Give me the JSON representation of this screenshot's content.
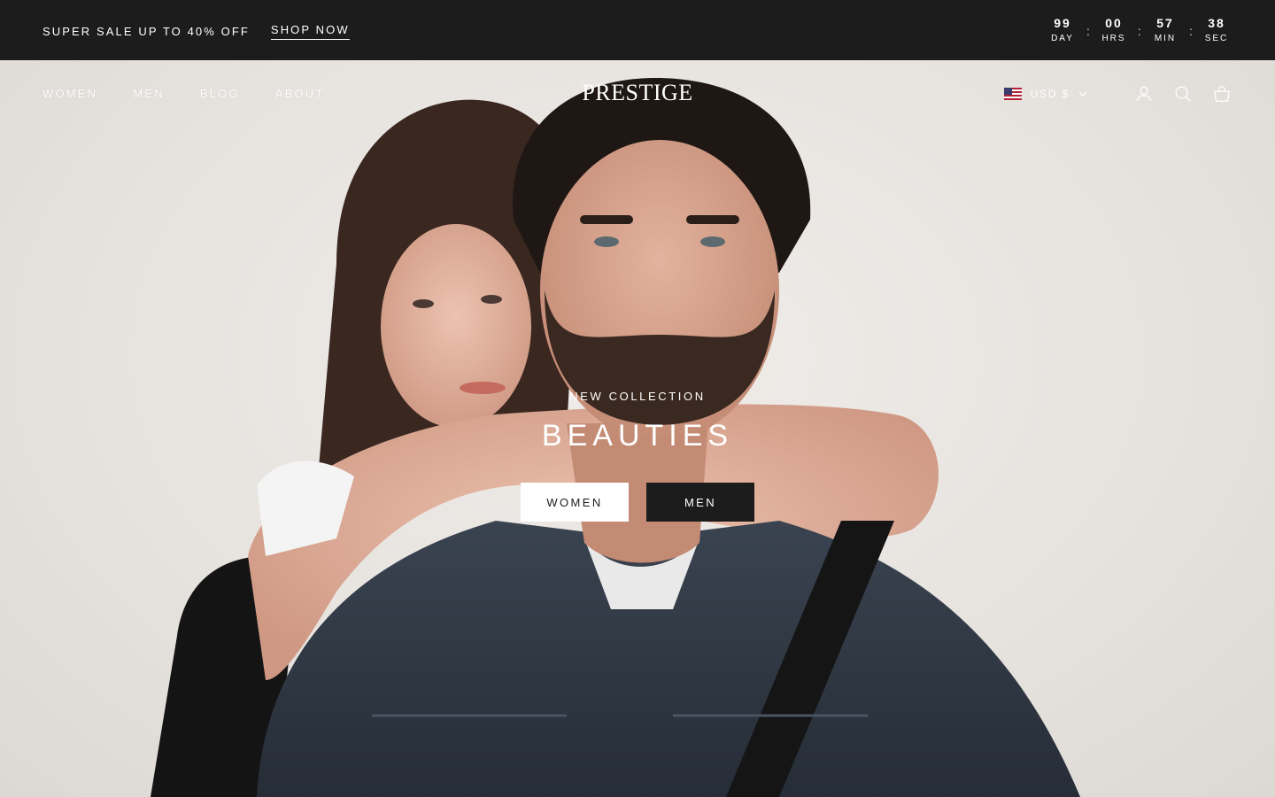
{
  "announcement": {
    "text": "SUPER SALE UP TO 40% OFF",
    "link_label": "SHOP NOW",
    "countdown": [
      {
        "value": "99",
        "label": "DAY"
      },
      {
        "value": "00",
        "label": "HRS"
      },
      {
        "value": "57",
        "label": "MIN"
      },
      {
        "value": "38",
        "label": "SEC"
      }
    ],
    "separator": ":"
  },
  "header": {
    "nav": [
      "WOMEN",
      "MEN",
      "BLOG",
      "ABOUT"
    ],
    "logo": "PRESTIGE",
    "currency": "USD $",
    "icons": [
      "flag-us-icon",
      "chevron-down-icon",
      "account-icon",
      "search-icon",
      "cart-icon"
    ]
  },
  "hero": {
    "eyebrow": "NEW COLLECTION",
    "title": "BEAUTIES",
    "buttons": [
      "WOMEN",
      "MEN"
    ]
  },
  "colors": {
    "bar_bg": "#1c1c1c",
    "text_light": "#ffffff",
    "hero_bg": "#e8e5e2",
    "denim": "#2c3440"
  }
}
